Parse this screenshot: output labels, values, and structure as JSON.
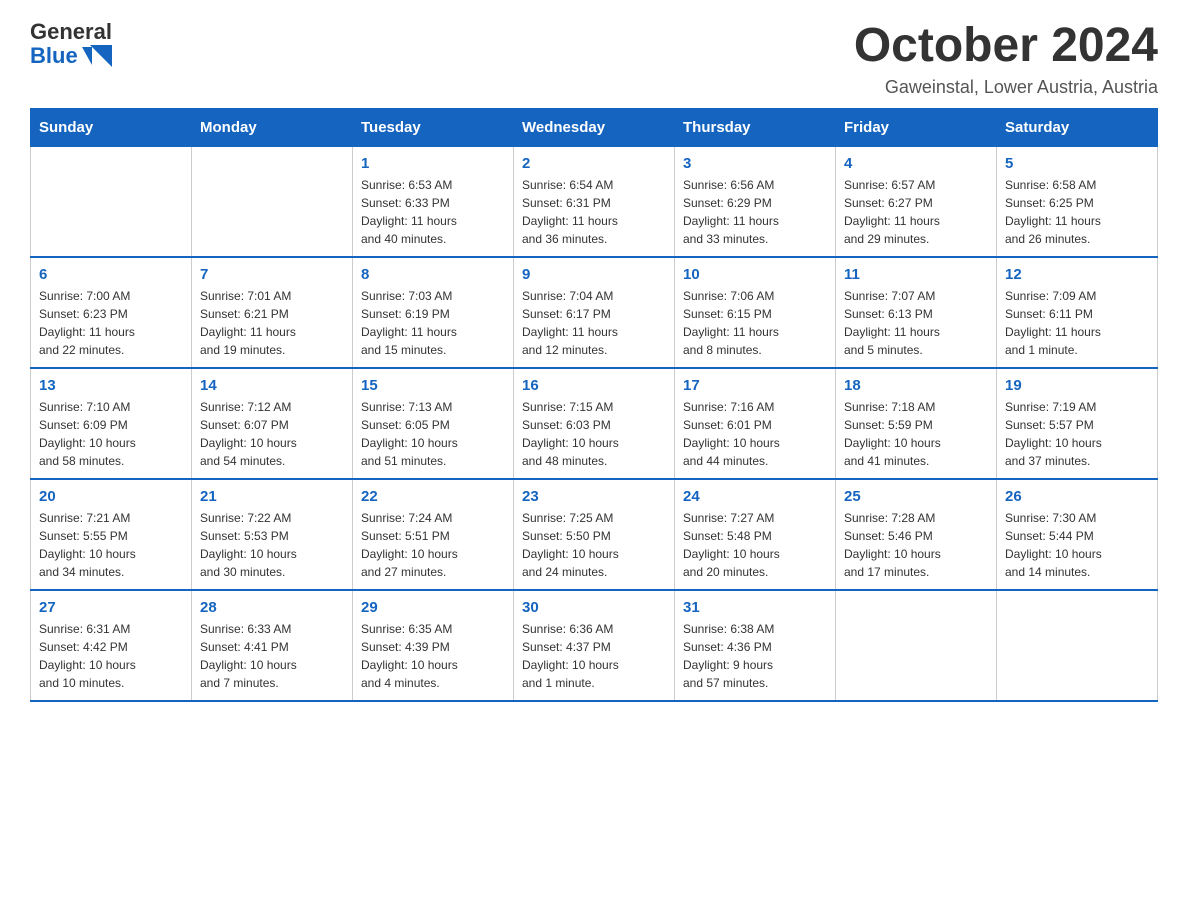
{
  "header": {
    "logo_general": "General",
    "logo_blue": "Blue",
    "month_title": "October 2024",
    "subtitle": "Gaweinstal, Lower Austria, Austria"
  },
  "columns": [
    "Sunday",
    "Monday",
    "Tuesday",
    "Wednesday",
    "Thursday",
    "Friday",
    "Saturday"
  ],
  "weeks": [
    [
      {
        "day": "",
        "info": ""
      },
      {
        "day": "",
        "info": ""
      },
      {
        "day": "1",
        "info": "Sunrise: 6:53 AM\nSunset: 6:33 PM\nDaylight: 11 hours\nand 40 minutes."
      },
      {
        "day": "2",
        "info": "Sunrise: 6:54 AM\nSunset: 6:31 PM\nDaylight: 11 hours\nand 36 minutes."
      },
      {
        "day": "3",
        "info": "Sunrise: 6:56 AM\nSunset: 6:29 PM\nDaylight: 11 hours\nand 33 minutes."
      },
      {
        "day": "4",
        "info": "Sunrise: 6:57 AM\nSunset: 6:27 PM\nDaylight: 11 hours\nand 29 minutes."
      },
      {
        "day": "5",
        "info": "Sunrise: 6:58 AM\nSunset: 6:25 PM\nDaylight: 11 hours\nand 26 minutes."
      }
    ],
    [
      {
        "day": "6",
        "info": "Sunrise: 7:00 AM\nSunset: 6:23 PM\nDaylight: 11 hours\nand 22 minutes."
      },
      {
        "day": "7",
        "info": "Sunrise: 7:01 AM\nSunset: 6:21 PM\nDaylight: 11 hours\nand 19 minutes."
      },
      {
        "day": "8",
        "info": "Sunrise: 7:03 AM\nSunset: 6:19 PM\nDaylight: 11 hours\nand 15 minutes."
      },
      {
        "day": "9",
        "info": "Sunrise: 7:04 AM\nSunset: 6:17 PM\nDaylight: 11 hours\nand 12 minutes."
      },
      {
        "day": "10",
        "info": "Sunrise: 7:06 AM\nSunset: 6:15 PM\nDaylight: 11 hours\nand 8 minutes."
      },
      {
        "day": "11",
        "info": "Sunrise: 7:07 AM\nSunset: 6:13 PM\nDaylight: 11 hours\nand 5 minutes."
      },
      {
        "day": "12",
        "info": "Sunrise: 7:09 AM\nSunset: 6:11 PM\nDaylight: 11 hours\nand 1 minute."
      }
    ],
    [
      {
        "day": "13",
        "info": "Sunrise: 7:10 AM\nSunset: 6:09 PM\nDaylight: 10 hours\nand 58 minutes."
      },
      {
        "day": "14",
        "info": "Sunrise: 7:12 AM\nSunset: 6:07 PM\nDaylight: 10 hours\nand 54 minutes."
      },
      {
        "day": "15",
        "info": "Sunrise: 7:13 AM\nSunset: 6:05 PM\nDaylight: 10 hours\nand 51 minutes."
      },
      {
        "day": "16",
        "info": "Sunrise: 7:15 AM\nSunset: 6:03 PM\nDaylight: 10 hours\nand 48 minutes."
      },
      {
        "day": "17",
        "info": "Sunrise: 7:16 AM\nSunset: 6:01 PM\nDaylight: 10 hours\nand 44 minutes."
      },
      {
        "day": "18",
        "info": "Sunrise: 7:18 AM\nSunset: 5:59 PM\nDaylight: 10 hours\nand 41 minutes."
      },
      {
        "day": "19",
        "info": "Sunrise: 7:19 AM\nSunset: 5:57 PM\nDaylight: 10 hours\nand 37 minutes."
      }
    ],
    [
      {
        "day": "20",
        "info": "Sunrise: 7:21 AM\nSunset: 5:55 PM\nDaylight: 10 hours\nand 34 minutes."
      },
      {
        "day": "21",
        "info": "Sunrise: 7:22 AM\nSunset: 5:53 PM\nDaylight: 10 hours\nand 30 minutes."
      },
      {
        "day": "22",
        "info": "Sunrise: 7:24 AM\nSunset: 5:51 PM\nDaylight: 10 hours\nand 27 minutes."
      },
      {
        "day": "23",
        "info": "Sunrise: 7:25 AM\nSunset: 5:50 PM\nDaylight: 10 hours\nand 24 minutes."
      },
      {
        "day": "24",
        "info": "Sunrise: 7:27 AM\nSunset: 5:48 PM\nDaylight: 10 hours\nand 20 minutes."
      },
      {
        "day": "25",
        "info": "Sunrise: 7:28 AM\nSunset: 5:46 PM\nDaylight: 10 hours\nand 17 minutes."
      },
      {
        "day": "26",
        "info": "Sunrise: 7:30 AM\nSunset: 5:44 PM\nDaylight: 10 hours\nand 14 minutes."
      }
    ],
    [
      {
        "day": "27",
        "info": "Sunrise: 6:31 AM\nSunset: 4:42 PM\nDaylight: 10 hours\nand 10 minutes."
      },
      {
        "day": "28",
        "info": "Sunrise: 6:33 AM\nSunset: 4:41 PM\nDaylight: 10 hours\nand 7 minutes."
      },
      {
        "day": "29",
        "info": "Sunrise: 6:35 AM\nSunset: 4:39 PM\nDaylight: 10 hours\nand 4 minutes."
      },
      {
        "day": "30",
        "info": "Sunrise: 6:36 AM\nSunset: 4:37 PM\nDaylight: 10 hours\nand 1 minute."
      },
      {
        "day": "31",
        "info": "Sunrise: 6:38 AM\nSunset: 4:36 PM\nDaylight: 9 hours\nand 57 minutes."
      },
      {
        "day": "",
        "info": ""
      },
      {
        "day": "",
        "info": ""
      }
    ]
  ]
}
